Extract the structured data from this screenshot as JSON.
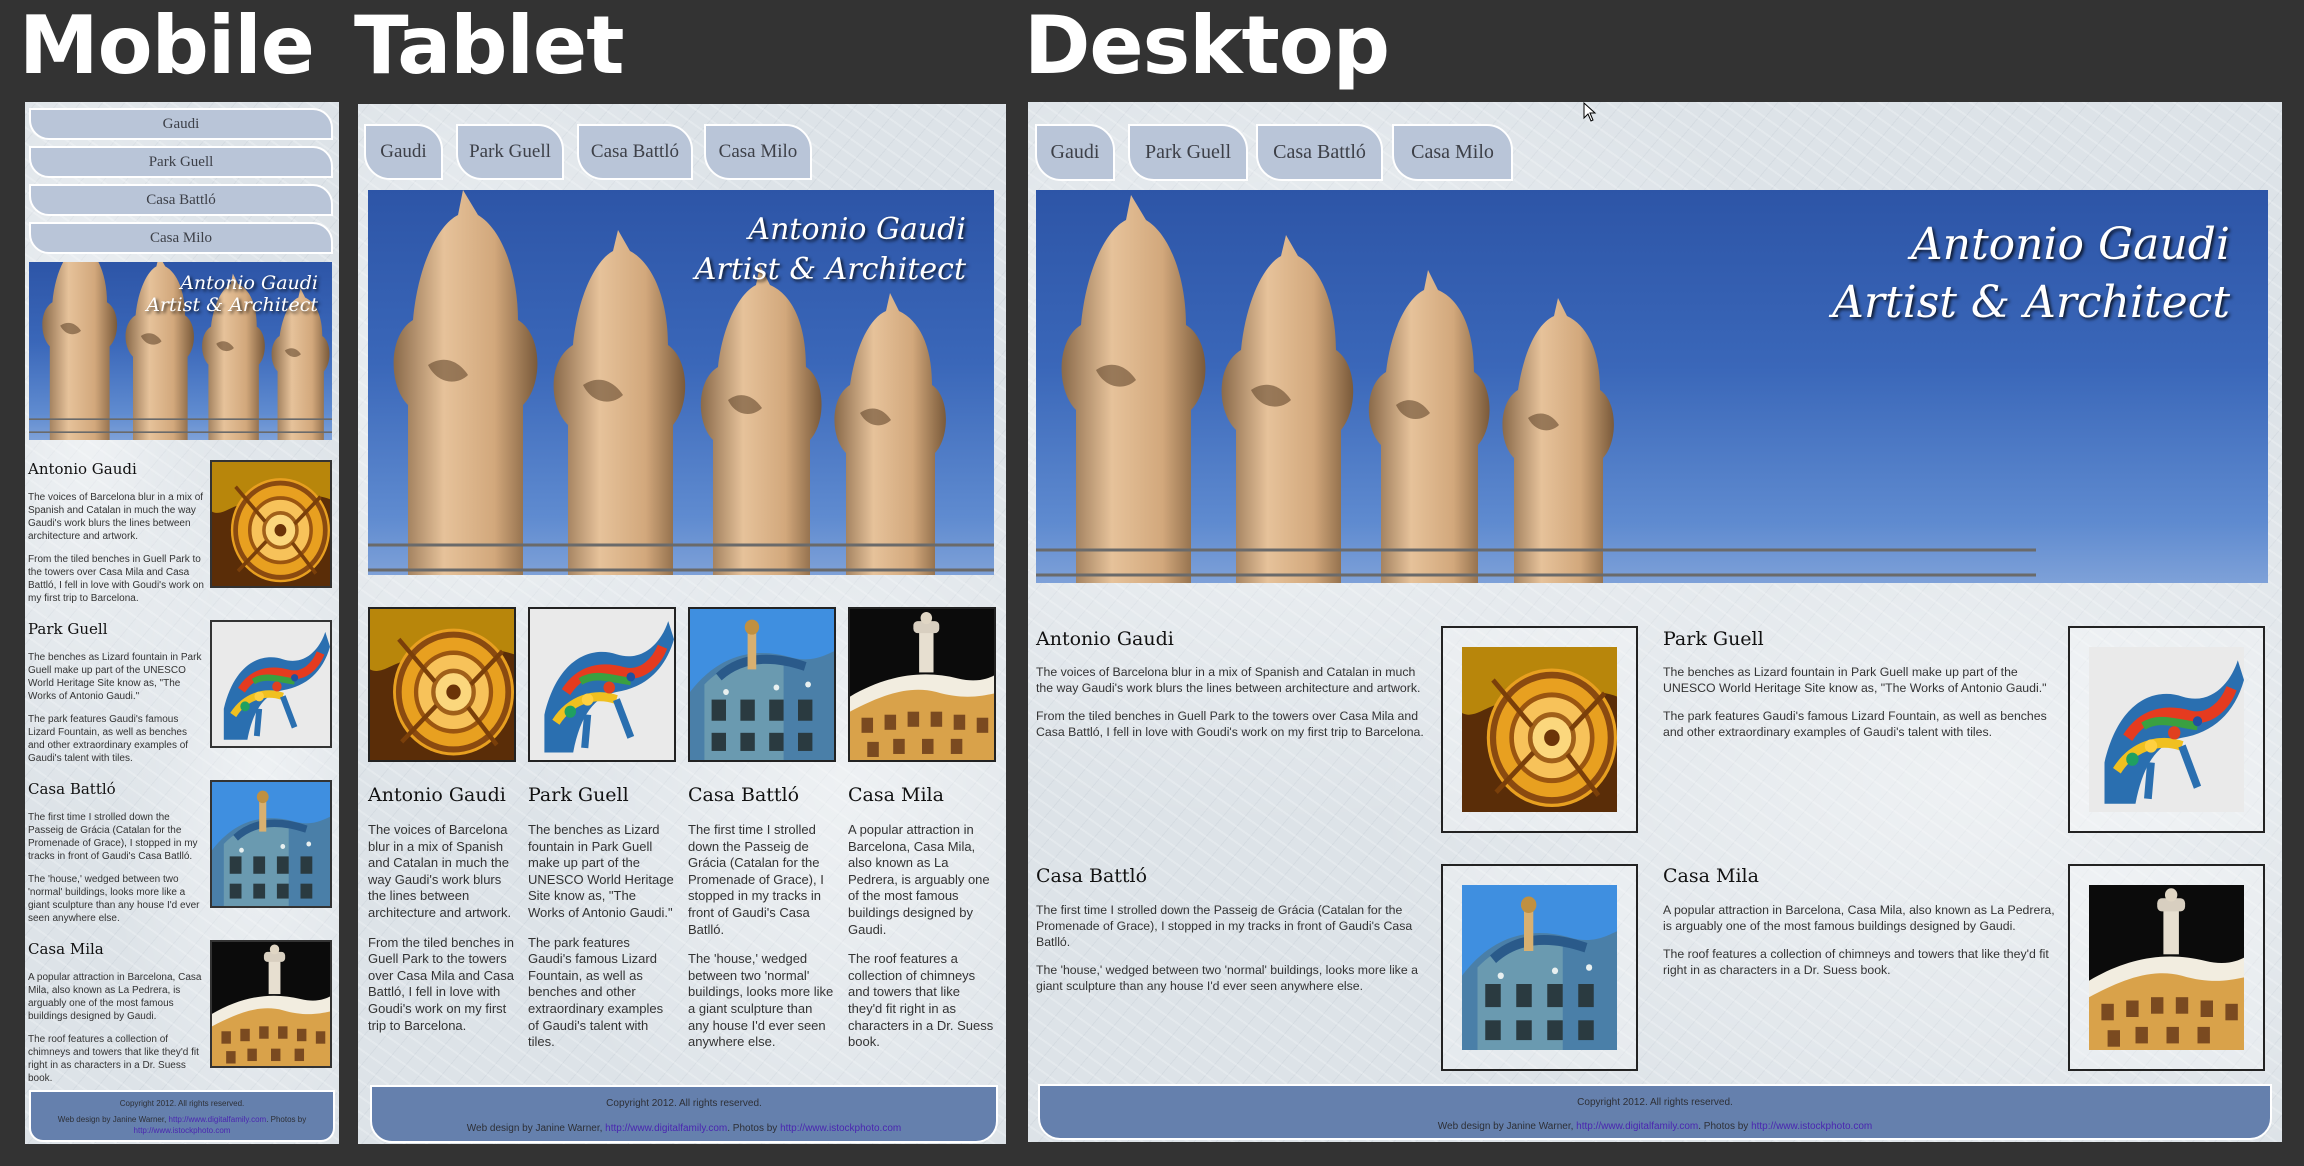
{
  "labels": {
    "mobile": "Mobile",
    "tablet": "Tablet",
    "desktop": "Desktop"
  },
  "nav": {
    "gaudi": "Gaudi",
    "park": "Park Guell",
    "batllo": "Casa Battló",
    "milo": "Casa Milo"
  },
  "hero": {
    "line1": "Antonio Gaudi",
    "line2": "Artist & Architect"
  },
  "sections": {
    "gaudi": {
      "title": "Antonio Gaudi",
      "p1": "The voices of Barcelona blur in a mix of Spanish and Catalan in much the way Gaudi's work blurs the lines between architecture and artwork.",
      "p2": "From the tiled benches in Guell Park to the towers over Casa Mila and Casa Battló, I fell in love with Goudi's work on my first trip to Barcelona."
    },
    "park": {
      "title": "Park Guell",
      "p1": "The benches as Lizard fountain in Park Guell make up part of the UNESCO World Heritage Site know as, \"The Works of Antonio Gaudi.\"",
      "p2": "The park features Gaudi's famous Lizard Fountain, as well as benches and other extraordinary examples of Gaudi's talent with tiles."
    },
    "batllo": {
      "title": "Casa Batlló",
      "title_alt": "Casa Battló",
      "p1": "The first time I strolled down the Passeig de Grácia (Catalan for the Promenade of Grace), I stopped in my tracks in front of Gaudi's Casa Batlló.",
      "p2": "The 'house,' wedged between two 'normal' buildings, looks more like a giant sculpture than any house I'd ever seen anywhere else."
    },
    "mila": {
      "title": "Casa Mila",
      "p1": "A popular attraction in Barcelona, Casa Mila, also known as La Pedrera, is arguably one of the most famous buildings designed by Gaudi.",
      "p2": "The roof features a collection of chimneys and towers that like they'd fit right in as characters in a Dr. Suess book."
    }
  },
  "footer": {
    "copyright": "Copyright 2012. All rights reserved.",
    "credit_pre": "Web design by Janine Warner, ",
    "credit_link1": "http://www.digitalfamily.com",
    "credit_mid": ". Photos by ",
    "credit_link2": "http://www.istockphoto.com"
  }
}
